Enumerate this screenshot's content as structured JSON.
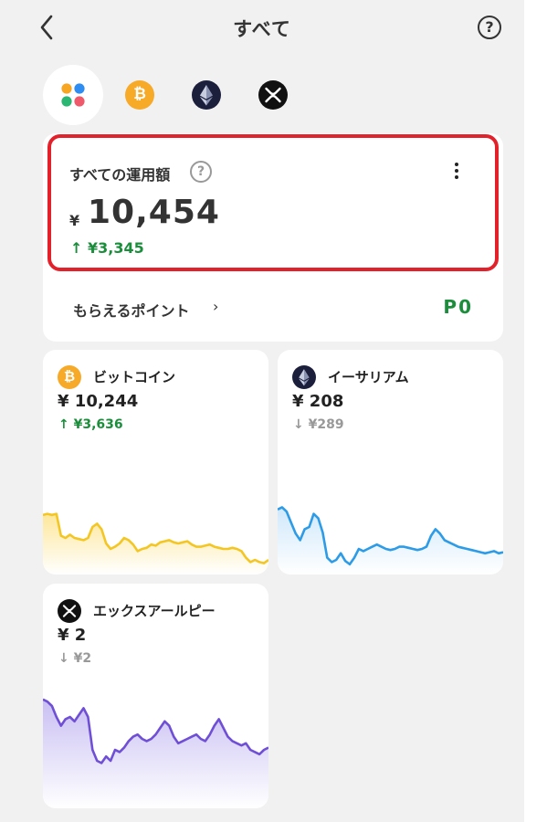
{
  "header": {
    "title": "すべて",
    "help_label": "?"
  },
  "coin_tabs": [
    {
      "name": "all",
      "icon": "grid-dots-icon"
    },
    {
      "name": "bitcoin",
      "icon": "bitcoin-icon",
      "glyph": "₿",
      "color": "#f7a928"
    },
    {
      "name": "ethereum",
      "icon": "ethereum-icon",
      "color": "#1b1f3b"
    },
    {
      "name": "xrp",
      "icon": "xrp-icon",
      "color": "#111111"
    }
  ],
  "summary": {
    "label": "すべての運用額",
    "help": "?",
    "currency": "¥",
    "total": "10,454",
    "change": "↑ ¥3,345",
    "change_color": "#1b8e3c"
  },
  "points": {
    "label": "もらえるポイント",
    "chevron": "›",
    "value": "P0"
  },
  "assets": [
    {
      "name": "ビットコイン",
      "amount": "¥ 10,244",
      "change": "↑ ¥3,636",
      "change_color": "#1b8e3c",
      "line_color": "#f3c623",
      "fill_color": "#fde79a",
      "series": [
        51,
        52,
        51,
        52,
        32,
        30,
        33,
        30,
        29,
        28,
        30,
        40,
        43,
        38,
        25,
        20,
        22,
        25,
        30,
        28,
        24,
        18,
        20,
        21,
        24,
        23,
        26,
        27,
        28,
        26,
        25,
        26,
        27,
        24,
        22,
        22,
        23,
        24,
        22,
        21,
        20,
        20,
        21,
        20,
        18,
        12,
        8,
        10,
        8,
        7,
        10
      ]
    },
    {
      "name": "イーサリアム",
      "amount": "¥ 208",
      "change": "↓ ¥289",
      "change_color": "#999999",
      "line_color": "#2d9be6",
      "fill_color": "#cfe8fb",
      "series": [
        56,
        58,
        54,
        44,
        34,
        28,
        38,
        40,
        52,
        48,
        35,
        12,
        8,
        10,
        16,
        9,
        6,
        12,
        20,
        18,
        20,
        22,
        24,
        22,
        20,
        19,
        20,
        22,
        22,
        21,
        20,
        19,
        20,
        22,
        32,
        38,
        34,
        28,
        26,
        24,
        22,
        21,
        20,
        19,
        18,
        17,
        16,
        17,
        18,
        16,
        17
      ]
    },
    {
      "name": "エックスアールピー",
      "amount": "¥ 2",
      "change": "↓ ¥2",
      "change_color": "#999999",
      "line_color": "#6e4fd6",
      "fill_color": "#c9bff3",
      "series": [
        96,
        94,
        90,
        80,
        72,
        78,
        80,
        76,
        82,
        88,
        80,
        50,
        40,
        38,
        44,
        40,
        50,
        48,
        52,
        58,
        62,
        64,
        60,
        58,
        60,
        64,
        70,
        76,
        72,
        62,
        56,
        58,
        60,
        62,
        64,
        60,
        58,
        64,
        72,
        78,
        70,
        62,
        58,
        56,
        54,
        56,
        50,
        48,
        46,
        50,
        52
      ]
    }
  ]
}
